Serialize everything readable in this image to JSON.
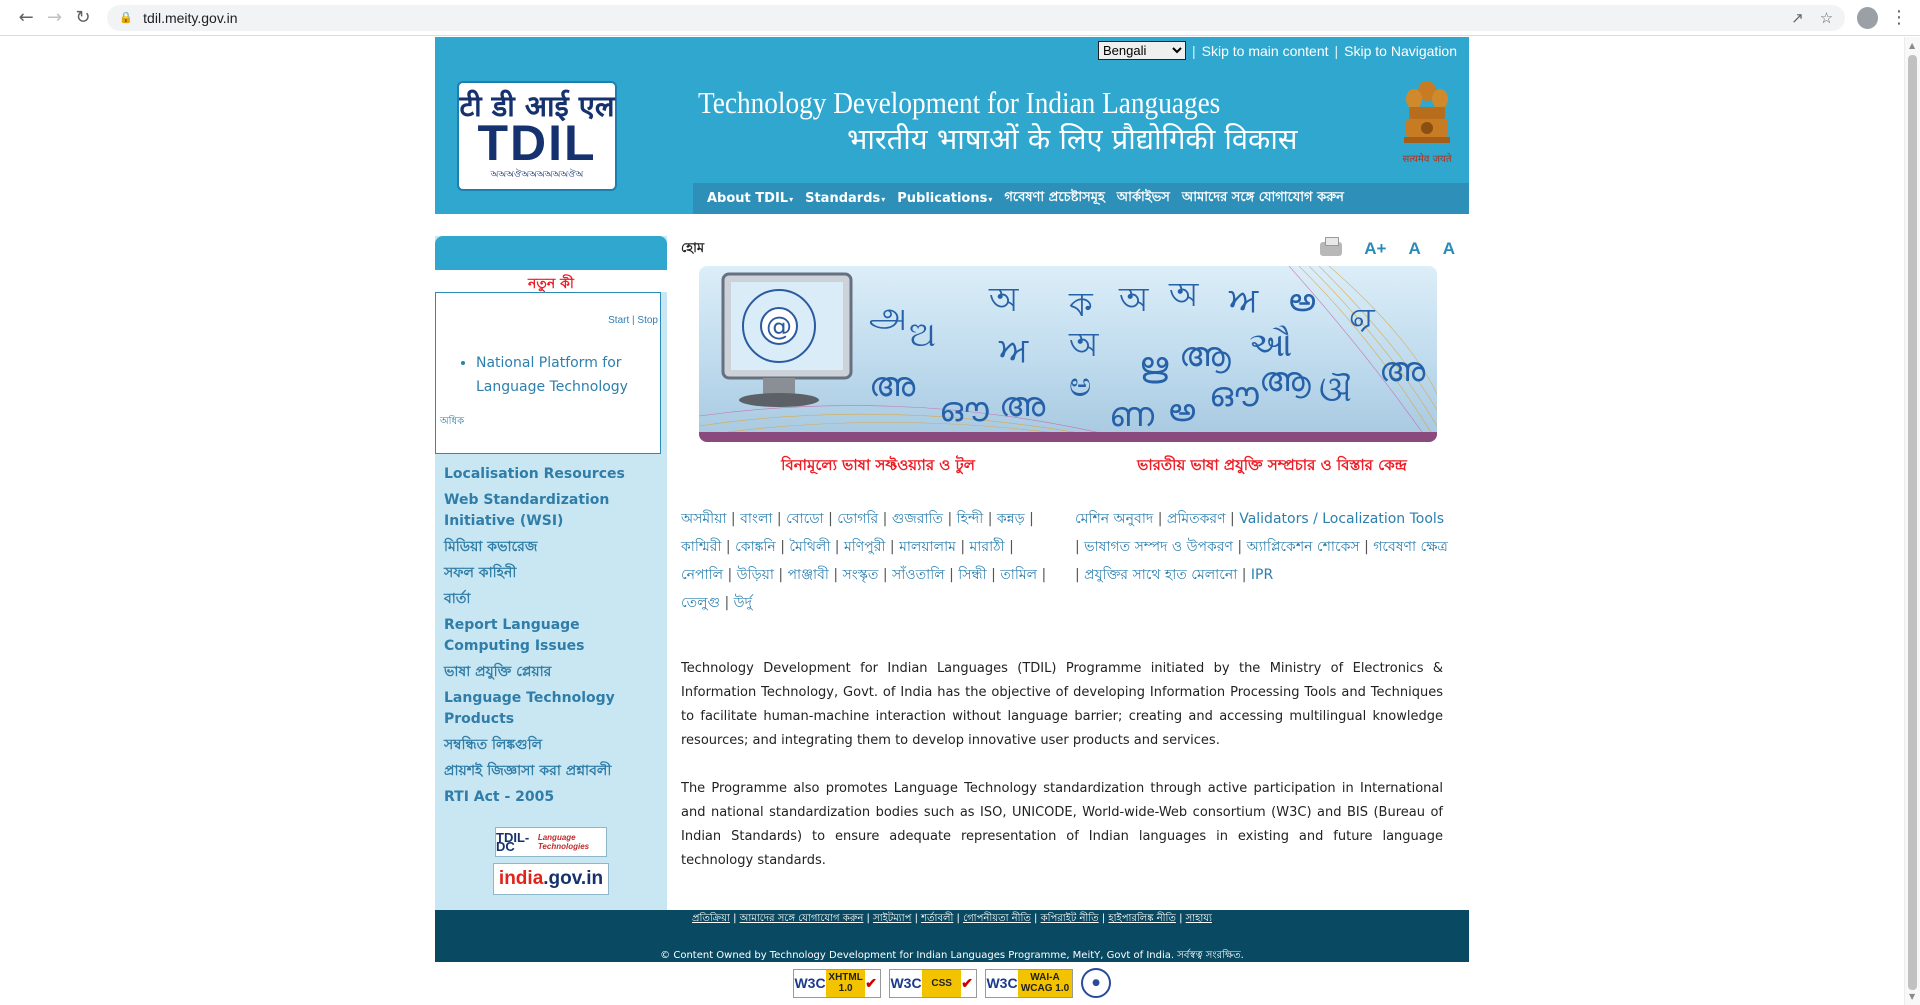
{
  "browser": {
    "url": "tdil.meity.gov.in"
  },
  "topbar": {
    "language_selected": "Bengali",
    "skip_main": "Skip to main content",
    "skip_nav": "Skip to Navigation",
    "separator": "|"
  },
  "header": {
    "logo_hindi": "टी डी आई एल",
    "logo_main": "TDIL",
    "logo_bottom": "অঅঅঔঅঅঅঅঅঅঔঅ",
    "title_en": "Technology Development for Indian Languages",
    "title_hi": "भारतीय भाषाओं के लिए प्रौद्योगिकी विकास",
    "emblem_motto": "सत्यमेव जयते"
  },
  "mainnav": [
    {
      "label": "About TDIL",
      "caret": "▾"
    },
    {
      "label": "Standards",
      "caret": "▾"
    },
    {
      "label": "Publications",
      "caret": "▾"
    },
    {
      "label": "গবেষণা প্রচেষ্টাসমূহ",
      "caret": ""
    },
    {
      "label": "আর্কাইভস",
      "caret": ""
    },
    {
      "label": "আমাদের সঙ্গে যোগাযোগ করুন",
      "caret": ""
    }
  ],
  "sidebar": {
    "whats_new": "নতুন কী",
    "start": "Start",
    "stop": "Stop",
    "marquee_item": "National Platform for Language Technology",
    "more": "অধিক",
    "links": [
      "Localisation Resources",
      "Web Standardization Initiative (WSI)",
      "মিডিয়া কভারেজ",
      "সফল কাহিনী",
      "বার্তা",
      "Report Language Computing Issues",
      "ভাষা প্রযুক্তি প্লেয়ার",
      "Language Technology Products",
      "সম্বন্ধিত লিঙ্কগুলি",
      "প্রায়শই জিজ্ঞাসা করা প্রশ্নাবলী",
      "RTI Act - 2005"
    ],
    "badge_tdildc": "TDIL-DC",
    "badge_tdildc_sub": "Language Technologies",
    "badge_india_a": "india",
    "badge_india_b": ".gov.in"
  },
  "main": {
    "breadcrumb": "হোম",
    "font_inc": "A+",
    "font_norm": "A",
    "font_alt": "A",
    "col1_title": "বিনামূল্যে ভাষা সফ্টওয়্যার ও টুল",
    "col2_title": "ভারতীয় ভাষা প্রযুক্তি সম্প্রচার ও বিস্তার কেন্দ্র",
    "col1_links": [
      "অসমীয়া",
      "বাংলা",
      "বোডো",
      "ডোগরি",
      "গুজরাতি",
      "হিন্দী",
      "কন্নড়",
      "কাশ্মিরী",
      "কোঙ্কনি",
      "মৈথিলী",
      "মণিপুরী",
      "মালয়ালাম",
      "মারাঠী",
      "নেপালি",
      "উড়িয়া",
      "পাঞ্জাবী",
      "সংস্কৃত",
      "সাঁওতালি",
      "সিন্ধী",
      "তামিল",
      "তেলুগু",
      "উর্দু"
    ],
    "col2_links": [
      "মেশিন অনুবাদ",
      "প্রমিতকরণ",
      "Validators / Localization Tools",
      "ভাষাগত সম্পদ ও উপকরণ",
      "অ্যাপ্লিকেশন শোকেস",
      "গবেষণা ক্ষেত্র",
      "প্রযুক্তির সাথে হাত মেলানো",
      "IPR"
    ],
    "para1": "Technology Development for Indian Languages (TDIL) Programme initiated by the Ministry of Electronics & Information Technology, Govt. of India has the objective of developing Information Processing Tools and Techniques to facilitate human-machine interaction without language barrier; creating and accessing multilingual knowledge resources; and integrating them to develop innovative user products and services.",
    "para2": "The Programme also promotes Language Technology standardization through active participation in International and national standardization bodies such as ISO, UNICODE, World-wide-Web consortium (W3C) and BIS (Bureau of Indian Standards) to ensure adequate representation of Indian languages in existing and future language technology standards."
  },
  "footer": {
    "links": [
      "প্রতিক্রিয়া",
      "আমাদের সঙ্গে যোগাযোগ করুন",
      "সাইটম্যাপ",
      "শর্তাবলী",
      "গোপনীয়তা নীতি",
      "কপিরাইট নীতি",
      "হাইপারলিঙ্ক নীতি",
      "সাহায্য"
    ],
    "copyright": "© Content Owned by Technology Development for Indian Languages Programme, MeitY, Govt of India. সর্বস্বত্ব সংরক্ষিত.",
    "badge_xhtml": "XHTML 1.0",
    "badge_css": "CSS",
    "badge_wcag": "WAI-A WCAG 1.0",
    "w3c": "W3C"
  },
  "banner_glyphs": [
    "অ",
    "ক",
    "অ",
    "অ",
    "ਅ",
    "అ",
    "ஏ",
    "அ",
    "ଅ",
    "ਅ",
    "অ",
    "ഋ",
    "ആ",
    "ઔ",
    "ଔ",
    "അ",
    "അ",
    "ഔ",
    "അ",
    "ಅ",
    "ണ",
    "అ",
    "ഔ",
    "ആ"
  ],
  "colors": {
    "header": "#2fa7cf",
    "nav": "#2e90b9",
    "sidebar": "#c9e7f2",
    "link": "#2c7fae",
    "red_heading": "#ee1c25",
    "footer": "#094a62"
  }
}
